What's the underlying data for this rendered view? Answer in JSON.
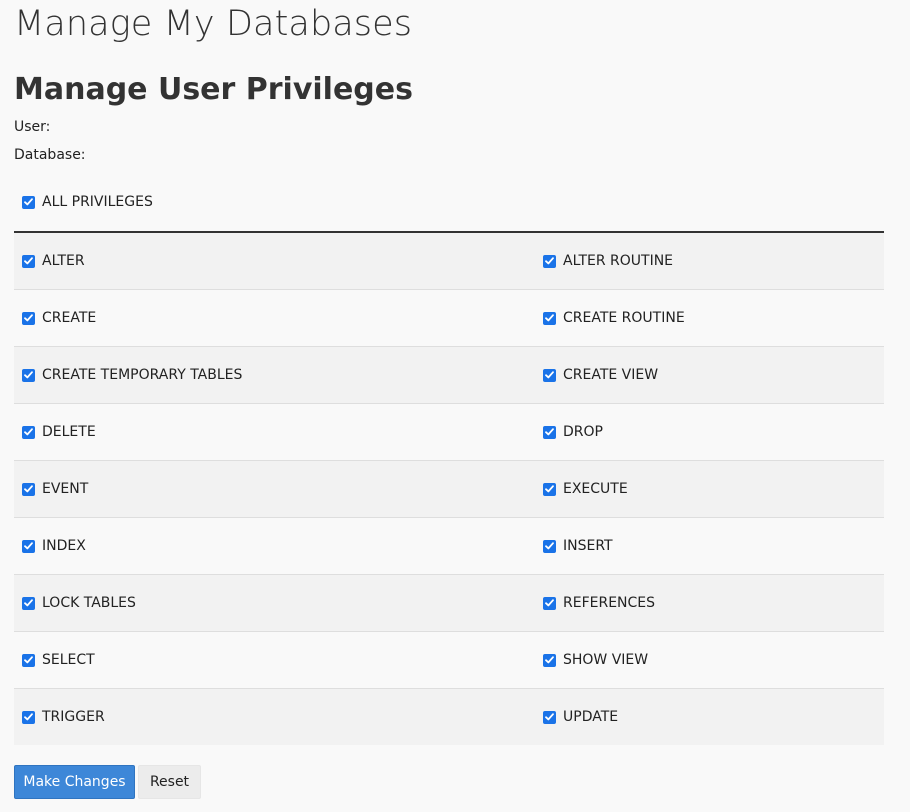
{
  "header": {
    "title": "Manage My Databases"
  },
  "section": {
    "title": "Manage User Privileges",
    "user_label": "User:",
    "database_label": "Database:"
  },
  "all_privileges": {
    "label": "ALL PRIVILEGES",
    "checked": true
  },
  "privileges": [
    {
      "left": {
        "label": "ALTER",
        "checked": true
      },
      "right": {
        "label": "ALTER ROUTINE",
        "checked": true
      }
    },
    {
      "left": {
        "label": "CREATE",
        "checked": true
      },
      "right": {
        "label": "CREATE ROUTINE",
        "checked": true
      }
    },
    {
      "left": {
        "label": "CREATE TEMPORARY TABLES",
        "checked": true
      },
      "right": {
        "label": "CREATE VIEW",
        "checked": true
      }
    },
    {
      "left": {
        "label": "DELETE",
        "checked": true
      },
      "right": {
        "label": "DROP",
        "checked": true
      }
    },
    {
      "left": {
        "label": "EVENT",
        "checked": true
      },
      "right": {
        "label": "EXECUTE",
        "checked": true
      }
    },
    {
      "left": {
        "label": "INDEX",
        "checked": true
      },
      "right": {
        "label": "INSERT",
        "checked": true
      }
    },
    {
      "left": {
        "label": "LOCK TABLES",
        "checked": true
      },
      "right": {
        "label": "REFERENCES",
        "checked": true
      }
    },
    {
      "left": {
        "label": "SELECT",
        "checked": true
      },
      "right": {
        "label": "SHOW VIEW",
        "checked": true
      }
    },
    {
      "left": {
        "label": "TRIGGER",
        "checked": true
      },
      "right": {
        "label": "UPDATE",
        "checked": true
      }
    }
  ],
  "actions": {
    "submit_label": "Make Changes",
    "reset_label": "Reset"
  },
  "colors": {
    "accent": "#3d87d8",
    "checkbox": "#1a73e8"
  }
}
